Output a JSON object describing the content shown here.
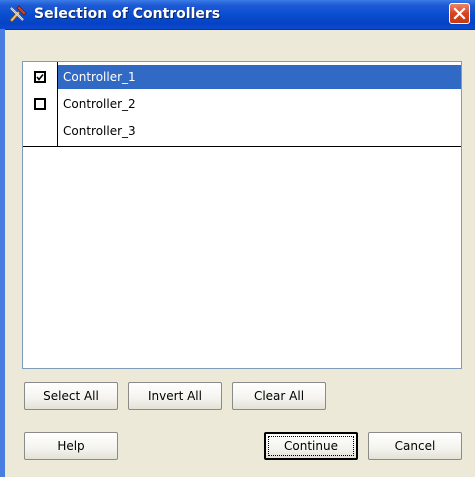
{
  "window": {
    "title": "Selection of Controllers",
    "icon": "app-tools-icon"
  },
  "controllers": [
    {
      "label": "Controller_1",
      "checked": true,
      "selected": true
    },
    {
      "label": "Controller_2",
      "checked": false,
      "selected": false
    },
    {
      "label": "Controller_3",
      "checked": false,
      "selected": false
    }
  ],
  "buttons": {
    "select_all": "Select All",
    "invert_all": "Invert All",
    "clear_all": "Clear All",
    "help": "Help",
    "continue": "Continue",
    "cancel": "Cancel"
  },
  "colors": {
    "title_bar": "#0a4ed0",
    "selection": "#316ac5",
    "dialog_background": "#ece9d8",
    "close_button": "#d9431f"
  }
}
